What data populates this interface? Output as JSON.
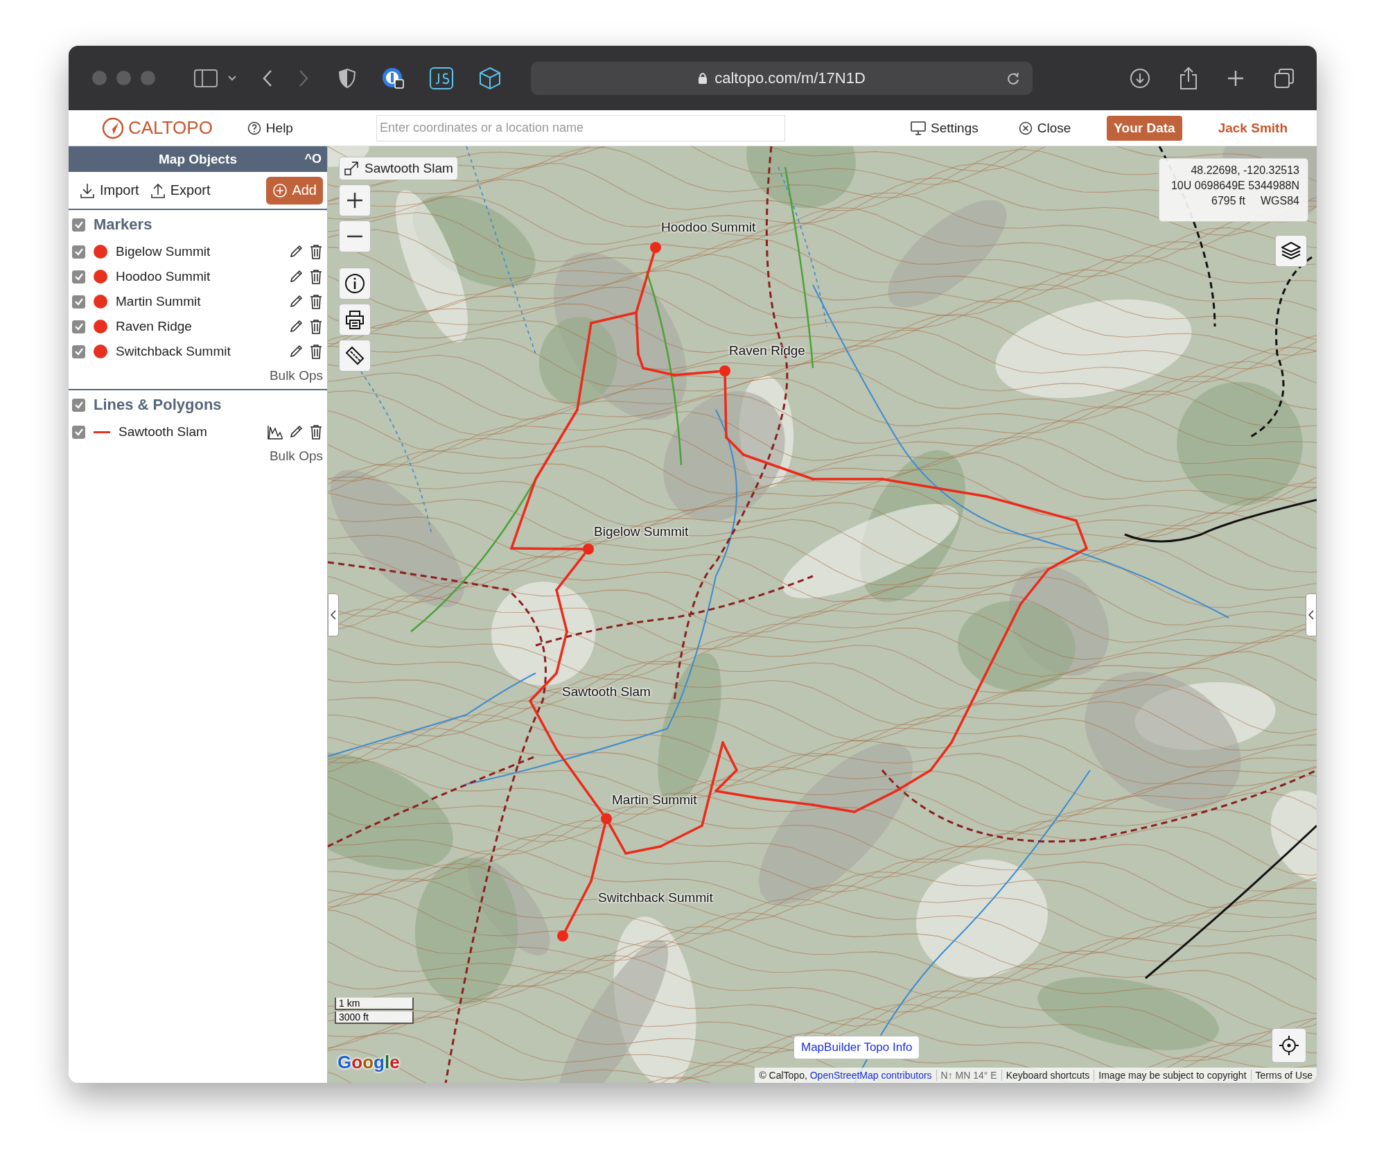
{
  "browser": {
    "url": "caltopo.com/m/17N1D"
  },
  "header": {
    "logo": "CALTOPO",
    "help": "Help",
    "search": {
      "placeholder": "Enter coordinates or a location name"
    },
    "settings": "Settings",
    "close": "Close",
    "your_data": "Your Data",
    "user": "Jack Smith"
  },
  "sidebar": {
    "title": "Map Objects",
    "shortcut": "^O",
    "import": "Import",
    "export": "Export",
    "add": "Add",
    "sections": [
      {
        "kind": "markers",
        "title": "Markers",
        "checked": true,
        "bulk_ops": "Bulk Ops",
        "items": [
          {
            "name": "Bigelow Summit",
            "checked": true,
            "color": "#e8301f"
          },
          {
            "name": "Hoodoo Summit",
            "checked": true,
            "color": "#e8301f"
          },
          {
            "name": "Martin Summit",
            "checked": true,
            "color": "#e8301f"
          },
          {
            "name": "Raven Ridge",
            "checked": true,
            "color": "#e8301f"
          },
          {
            "name": "Switchback Summit",
            "checked": true,
            "color": "#e8301f"
          }
        ]
      },
      {
        "kind": "lines",
        "title": "Lines & Polygons",
        "checked": true,
        "bulk_ops": "Bulk Ops",
        "items": [
          {
            "name": "Sawtooth Slam",
            "checked": true,
            "color": "#e8301f"
          }
        ]
      }
    ]
  },
  "map": {
    "title_button": "Sawtooth Slam",
    "coordinates": {
      "latlon": "48.22698, -120.32513",
      "utm": "10U 0698649E 5344988N",
      "elevation": "6795 ft",
      "datum": "WGS84"
    },
    "markers": [
      {
        "label": "Hoodoo Summit"
      },
      {
        "label": "Raven Ridge"
      },
      {
        "label": "Bigelow Summit"
      },
      {
        "label": "Martin Summit"
      },
      {
        "label": "Switchback Summit"
      }
    ],
    "track_label": "Sawtooth Slam",
    "scale": [
      "1 km",
      "3000 ft"
    ],
    "google": "Google",
    "info_button": "MapBuilder Topo Info",
    "attribution": {
      "copyright": "© CalTopo,",
      "osm_link": "OpenStreetMap contributors",
      "declination": "N↑ MN 14° E",
      "shortcuts": "Keyboard shortcuts",
      "notice": "Image may be subject to copyright",
      "terms": "Terms of Use"
    }
  }
}
